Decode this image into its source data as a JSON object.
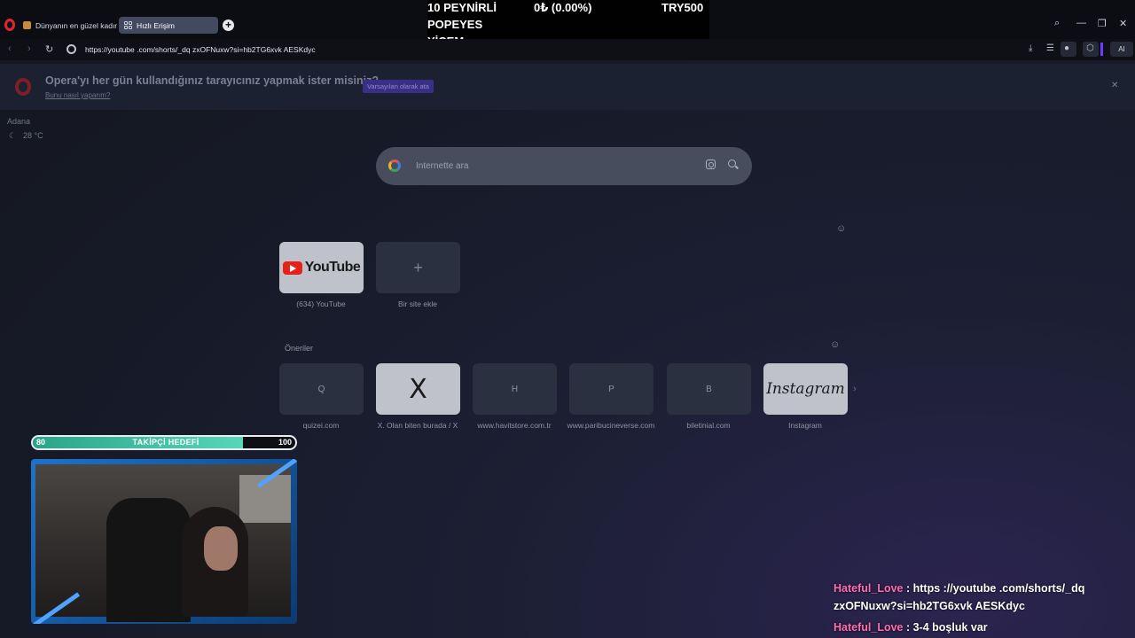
{
  "tabs": [
    {
      "label": "Dünyanın en güzel kadını",
      "active": false
    },
    {
      "label": "Hızlı Erişim",
      "active": true
    }
  ],
  "overlay": {
    "line1": "10 PEYNİRLİ",
    "line2": "POPEYES",
    "line3": "YİCEM",
    "change": "0₺ (0.00%)",
    "amount": "TRY500"
  },
  "address": {
    "url": "https://youtube .com/shorts/_dq zxOFNuxw?si=hb2TG6xvk AESKdyc",
    "ai_label": "AI"
  },
  "banner": {
    "question": "Opera'yı her gün kullandığınız tarayıcınız yapmak ister misiniz?",
    "help_link": "Bunu nasıl yaparım?",
    "default_button": "Varsayılan olarak ata"
  },
  "weather": {
    "city": "Adana",
    "temp": "28 °C"
  },
  "search": {
    "placeholder": "İnternette ara"
  },
  "speed_dial": [
    {
      "label": "(634) YouTube",
      "kind": "youtube",
      "logo": "YouTube"
    },
    {
      "label": "Bir site ekle",
      "kind": "add",
      "logo": "+"
    }
  ],
  "suggestions": {
    "title": "Öneriler",
    "items": [
      {
        "label": "quizei.com",
        "letter": "Q"
      },
      {
        "label": "X. Olan biten burada / X",
        "letter": "X"
      },
      {
        "label": "www.havitstore.com.tr",
        "letter": "H"
      },
      {
        "label": "www.paribucineverse.com",
        "letter": "P"
      },
      {
        "label": "biletinial.com",
        "letter": "B"
      },
      {
        "label": "Instagram",
        "letter": "Instagram"
      }
    ]
  },
  "goal": {
    "title": "TAKİPÇİ HEDEFİ",
    "current": "80",
    "target": "100",
    "progress": 0.8
  },
  "chat": [
    {
      "user": "Hateful_Love",
      "sep": " : ",
      "text": "https ://youtube .com/shorts/_dq zxOFNuxw?si=hb2TG6xvk AESKdyc"
    },
    {
      "user": "Hateful_Love",
      "sep": " : ",
      "text": "3-4 boşluk var"
    }
  ],
  "colors": {
    "accent": "#3a2f86",
    "goal_fill": "#2aa488",
    "chat_user": "#ff6fb3"
  }
}
